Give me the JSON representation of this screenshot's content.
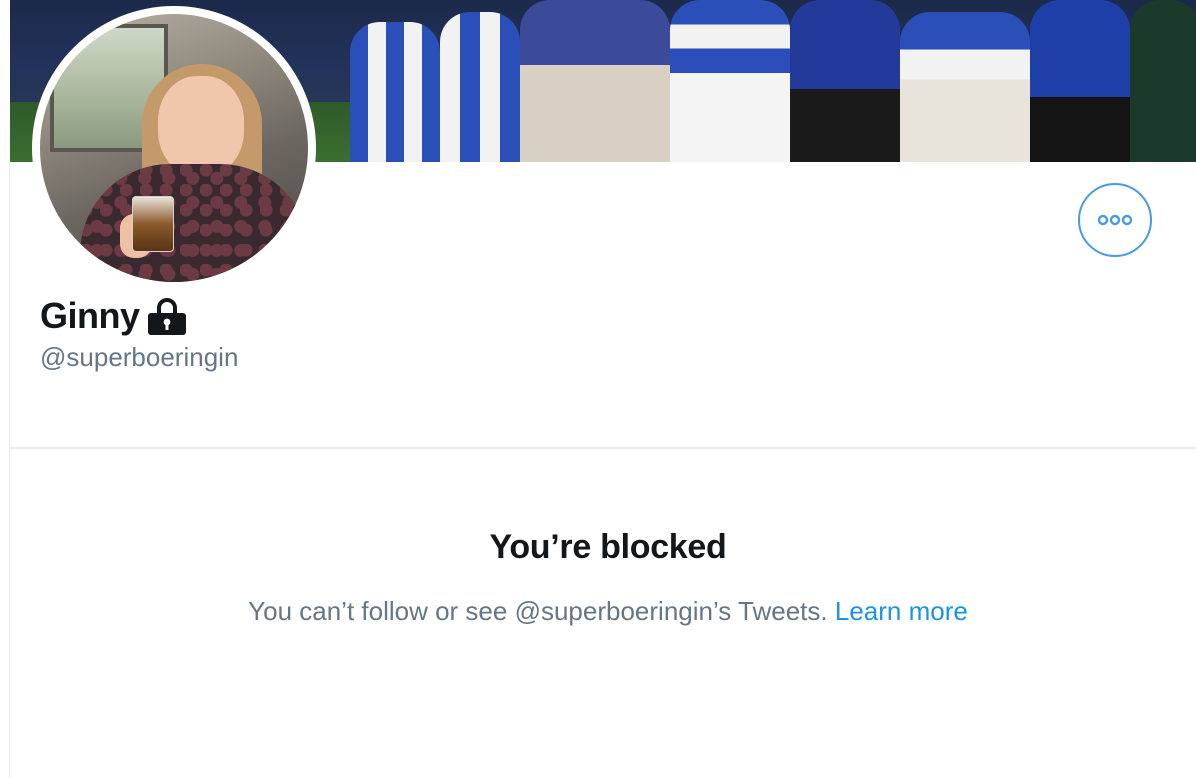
{
  "profile": {
    "display_name": "Ginny",
    "handle": "@superboeringin",
    "protected_icon": "lock-icon",
    "banner": "team-photo-banner",
    "avatar": "profile-photo"
  },
  "actions": {
    "more_icon": "more-options-icon"
  },
  "blocked": {
    "title": "You’re blocked",
    "message": "You can’t follow or see @superboeringin’s Tweets.",
    "link_label": "Learn more"
  },
  "colors": {
    "accent": "#1b95e0",
    "button_border": "#4a99e9",
    "muted_text": "#657786",
    "primary_text": "#14171a",
    "divider": "#e6ecf0"
  }
}
